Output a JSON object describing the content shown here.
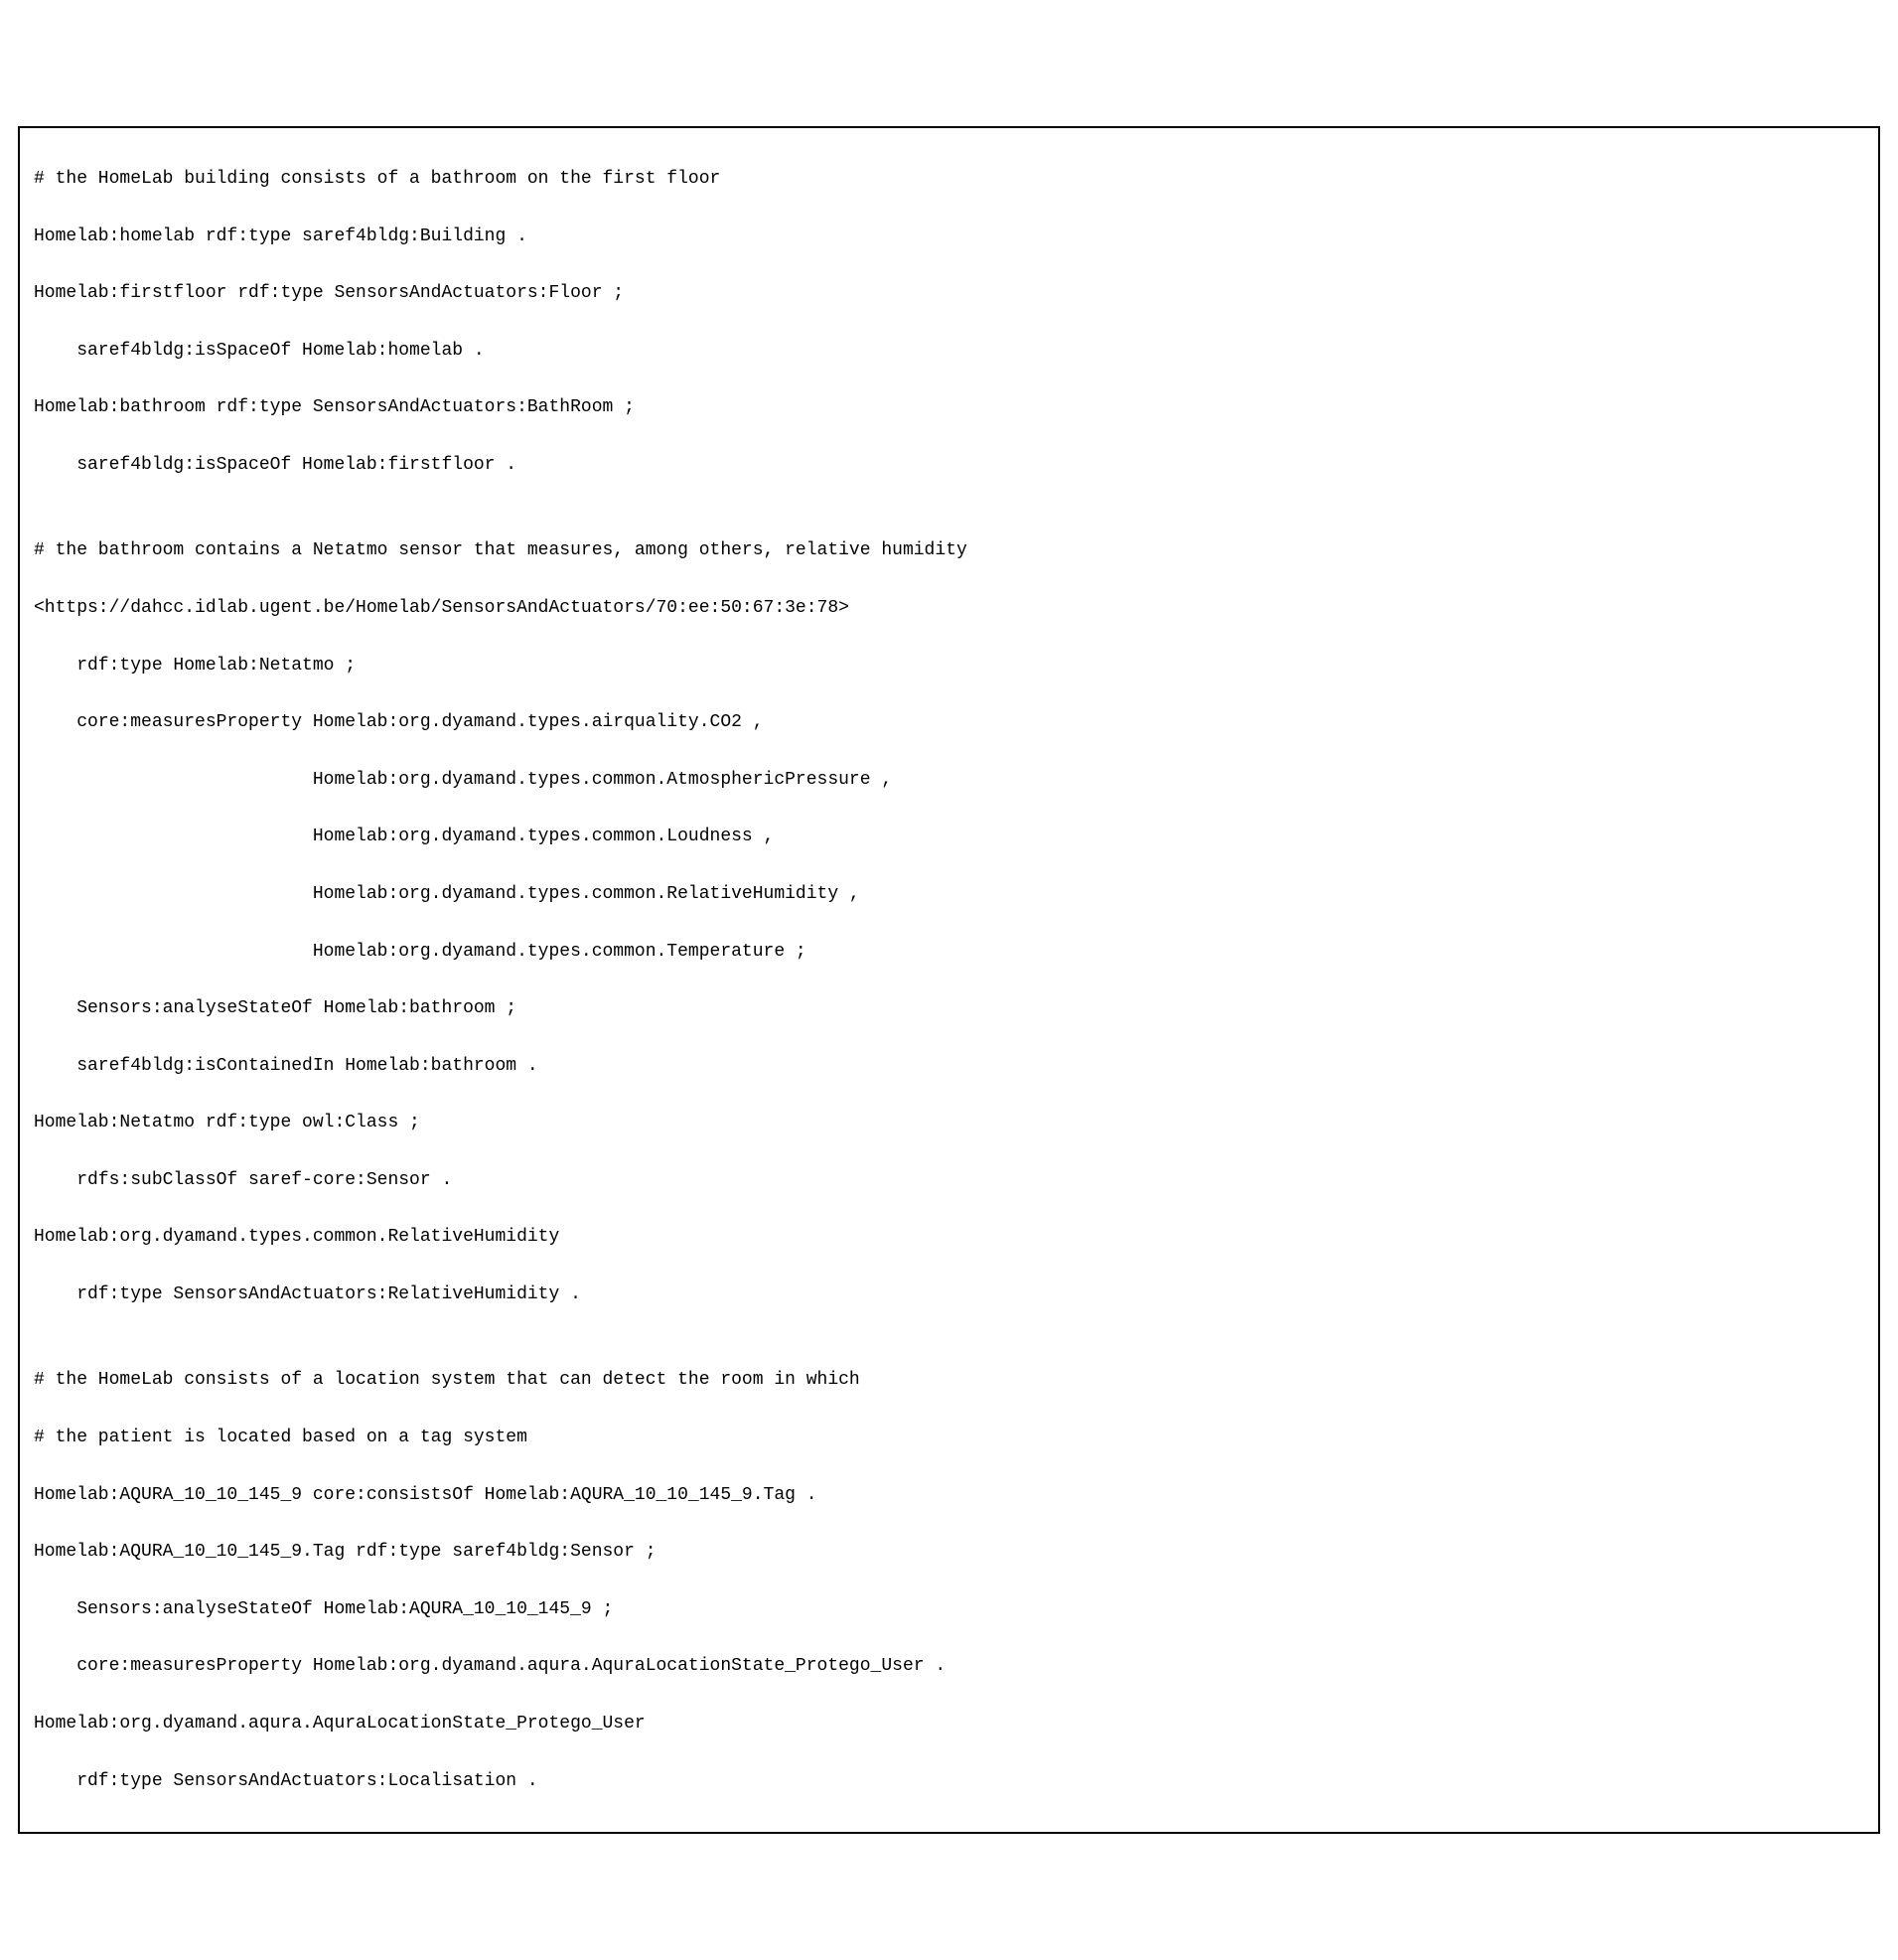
{
  "code": {
    "lines": [
      "# the HomeLab building consists of a bathroom on the first floor",
      "Homelab:homelab rdf:type saref4bldg:Building .",
      "Homelab:firstfloor rdf:type SensorsAndActuators:Floor ;",
      "    saref4bldg:isSpaceOf Homelab:homelab .",
      "Homelab:bathroom rdf:type SensorsAndActuators:BathRoom ;",
      "    saref4bldg:isSpaceOf Homelab:firstfloor .",
      "",
      "# the bathroom contains a Netatmo sensor that measures, among others, relative humidity",
      "<https://dahcc.idlab.ugent.be/Homelab/SensorsAndActuators/70:ee:50:67:3e:78>",
      "    rdf:type Homelab:Netatmo ;",
      "    core:measuresProperty Homelab:org.dyamand.types.airquality.CO2 ,",
      "                          Homelab:org.dyamand.types.common.AtmosphericPressure ,",
      "                          Homelab:org.dyamand.types.common.Loudness ,",
      "                          Homelab:org.dyamand.types.common.RelativeHumidity ,",
      "                          Homelab:org.dyamand.types.common.Temperature ;",
      "    Sensors:analyseStateOf Homelab:bathroom ;",
      "    saref4bldg:isContainedIn Homelab:bathroom .",
      "Homelab:Netatmo rdf:type owl:Class ;",
      "    rdfs:subClassOf saref-core:Sensor .",
      "Homelab:org.dyamand.types.common.RelativeHumidity",
      "    rdf:type SensorsAndActuators:RelativeHumidity .",
      "",
      "# the HomeLab consists of a location system that can detect the room in which",
      "# the patient is located based on a tag system",
      "Homelab:AQURA_10_10_145_9 core:consistsOf Homelab:AQURA_10_10_145_9.Tag .",
      "Homelab:AQURA_10_10_145_9.Tag rdf:type saref4bldg:Sensor ;",
      "    Sensors:analyseStateOf Homelab:AQURA_10_10_145_9 ;",
      "    core:measuresProperty Homelab:org.dyamand.aqura.AquraLocationState_Protego_User .",
      "Homelab:org.dyamand.aqura.AquraLocationState_Protego_User",
      "    rdf:type SensorsAndActuators:Localisation ."
    ]
  }
}
